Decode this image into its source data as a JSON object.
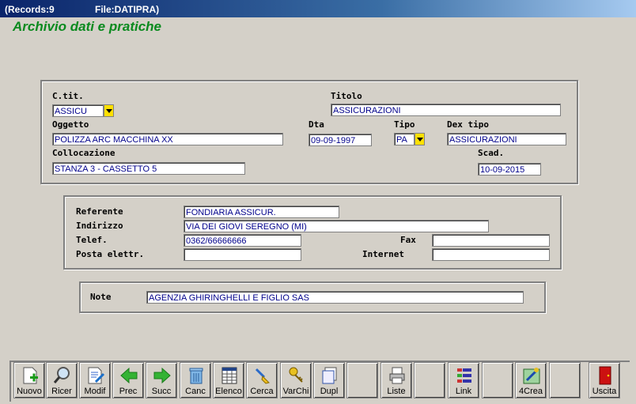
{
  "window": {
    "records": "(Records:9",
    "file": "File:DATIPRA)"
  },
  "app_title": "Archivio dati e pratiche",
  "form": {
    "ctit_label": "C.tit.",
    "ctit_value": "ASSICU",
    "titolo_label": "Titolo",
    "titolo_value": "ASSICURAZIONI",
    "oggetto_label": "Oggetto",
    "oggetto_value": "POLIZZA ARC MACCHINA XX",
    "dta_label": "Dta",
    "dta_value": "09-09-1997",
    "tipo_label": "Tipo",
    "tipo_value": "PA",
    "dex_tipo_label": "Dex tipo",
    "dex_tipo_value": "ASSICURAZIONI",
    "collocazione_label": "Collocazione",
    "collocazione_value": "STANZA 3 -  CASSETTO 5",
    "scad_label": "Scad.",
    "scad_value": "10-09-2015"
  },
  "contact": {
    "referente_label": "Referente",
    "referente_value": "FONDIARIA ASSICUR.",
    "indirizzo_label": "Indirizzo",
    "indirizzo_value": "VIA DEI GIOVI SEREGNO (MI)",
    "telef_label": "Telef.",
    "telef_value": "0362/66666666",
    "fax_label": "Fax",
    "fax_value": "",
    "posta_label": "Posta elettr.",
    "posta_value": "",
    "internet_label": "Internet",
    "internet_value": ""
  },
  "notes": {
    "label": "Note",
    "value": "AGENZIA GHIRINGHELLI E FIGLIO SAS"
  },
  "toolbar": [
    {
      "label": "Nuovo",
      "icon": "new-document-icon"
    },
    {
      "label": "Ricer",
      "icon": "magnifier-icon"
    },
    {
      "label": "Modif",
      "icon": "edit-document-icon"
    },
    {
      "label": "Prec",
      "icon": "arrow-left-icon"
    },
    {
      "label": "Succ",
      "icon": "arrow-right-icon"
    },
    {
      "label": "Canc",
      "icon": "trash-icon"
    },
    {
      "label": "Elenco",
      "icon": "table-icon"
    },
    {
      "label": "Cerca",
      "icon": "brush-icon"
    },
    {
      "label": "VarChi",
      "icon": "keys-icon"
    },
    {
      "label": "Dupl",
      "icon": "duplicate-icon"
    },
    {
      "label": "",
      "icon": ""
    },
    {
      "label": "Liste",
      "icon": "printer-icon"
    },
    {
      "label": "",
      "icon": ""
    },
    {
      "label": "Link",
      "icon": "link-icon"
    },
    {
      "label": "",
      "icon": ""
    },
    {
      "label": "4Crea",
      "icon": "create-icon"
    },
    {
      "label": "",
      "icon": ""
    },
    {
      "label": "Uscita",
      "icon": "exit-door-icon"
    }
  ]
}
